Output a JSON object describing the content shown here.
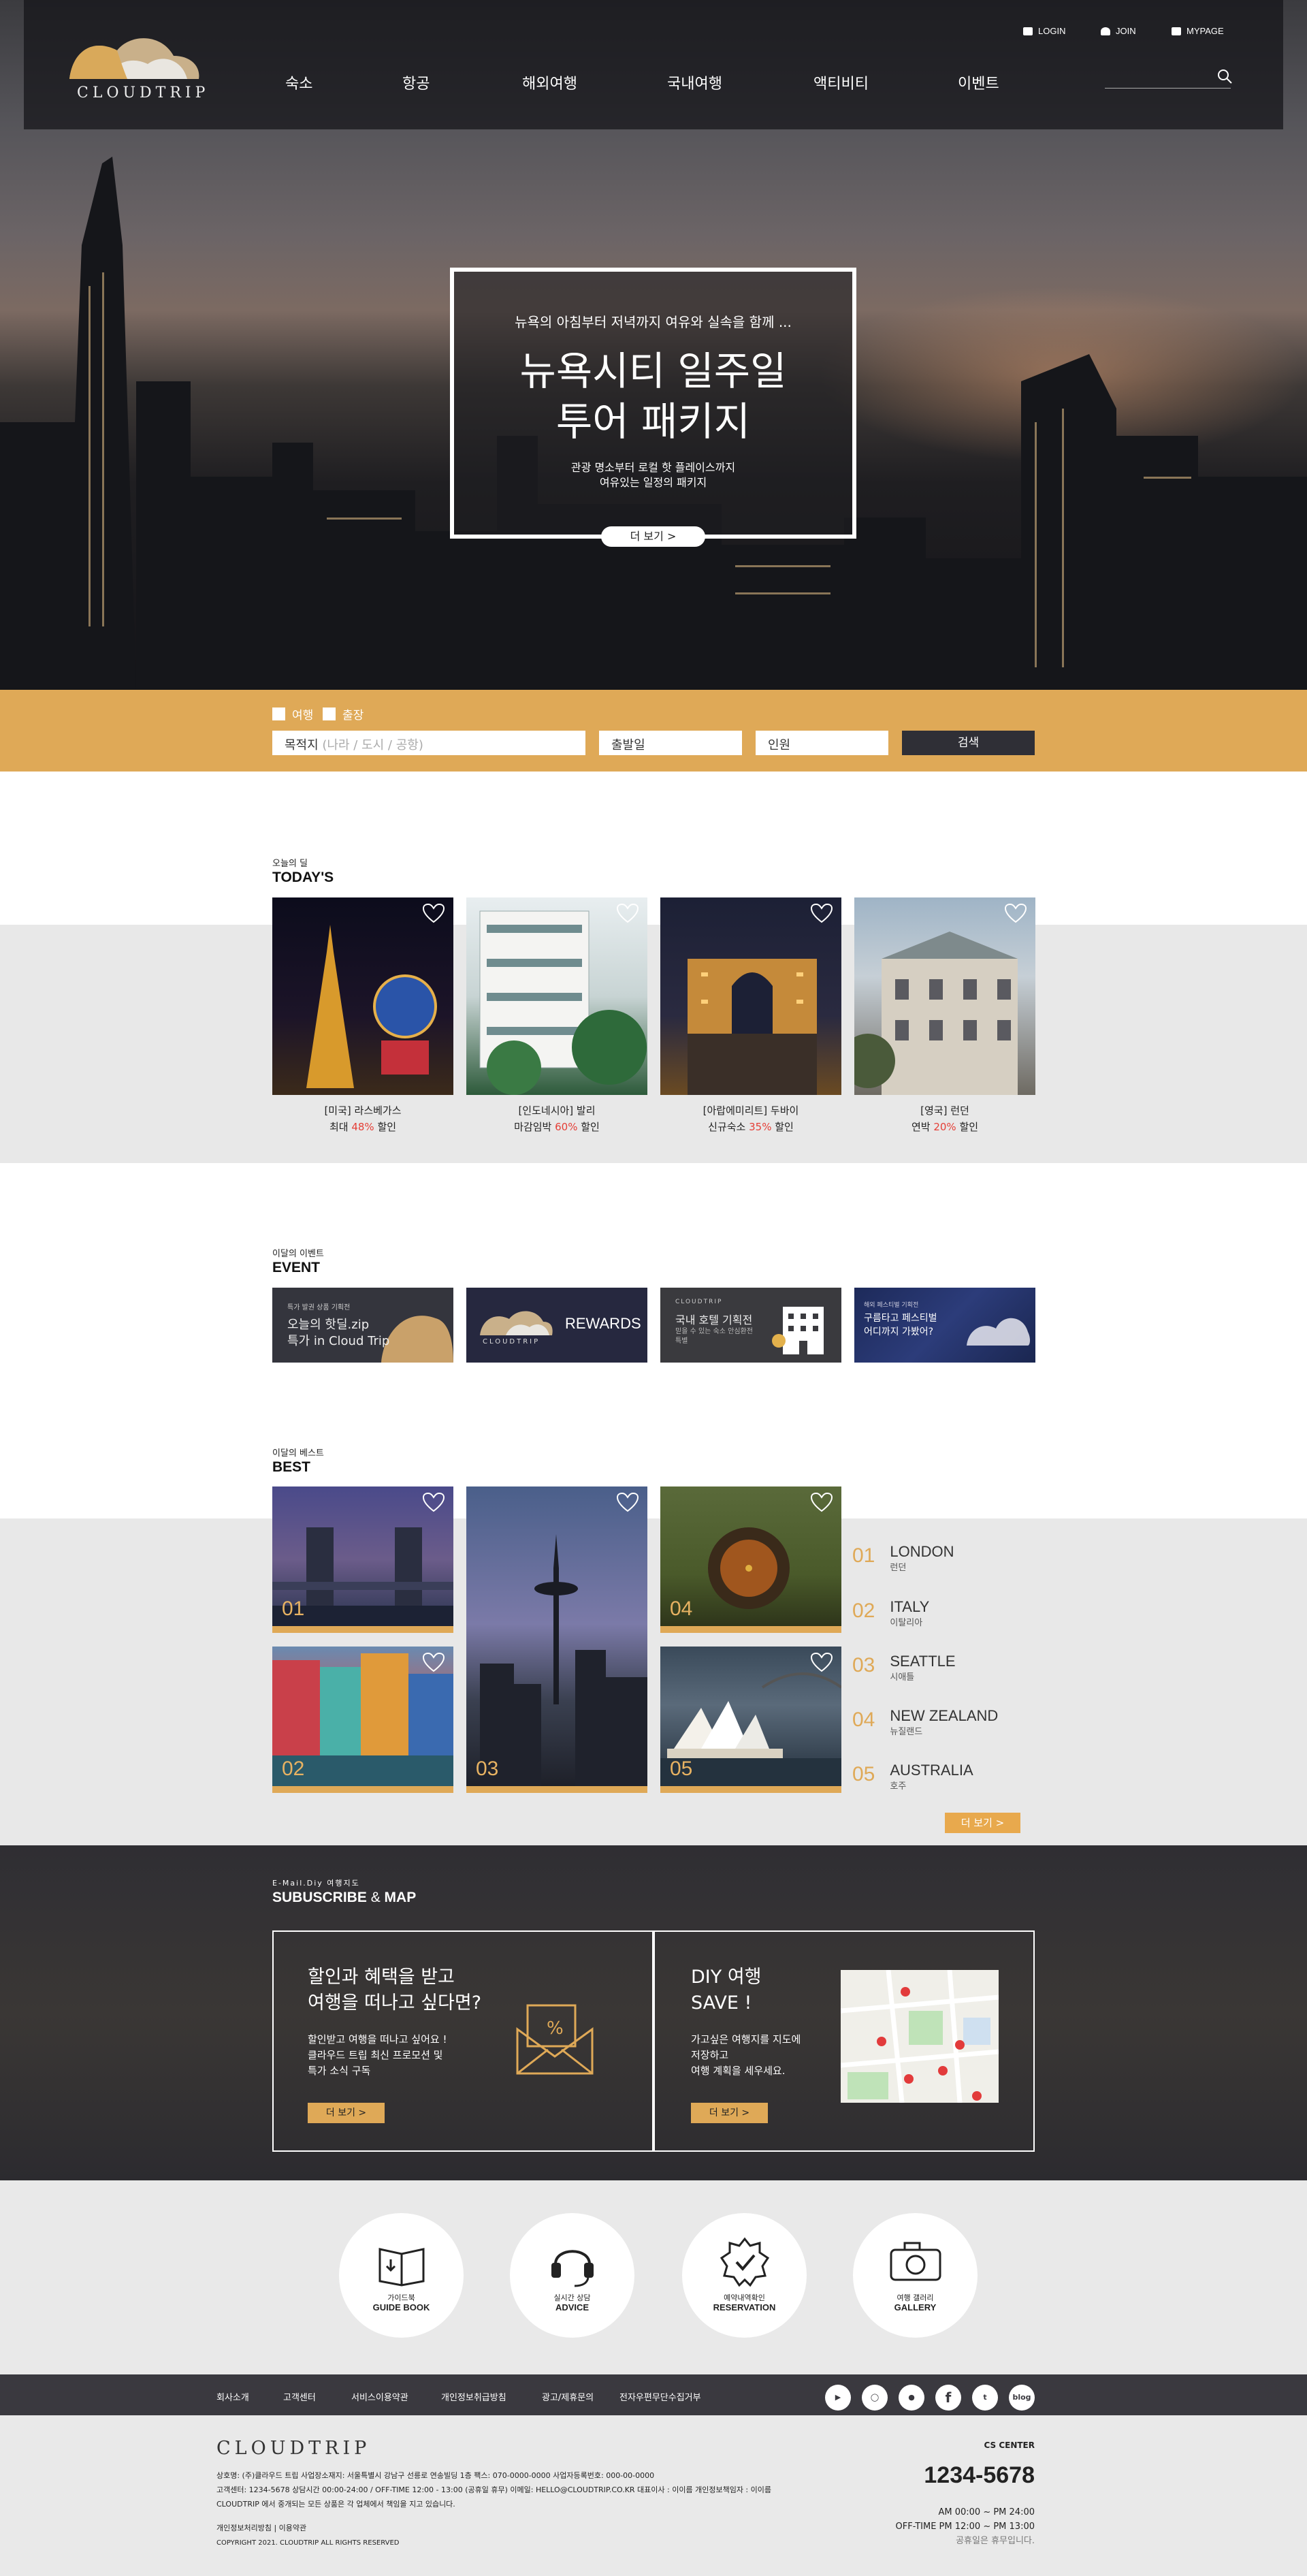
{
  "header": {
    "logo": "CLOUDTRIP",
    "util": {
      "login": "LOGIN",
      "join": "JOIN",
      "mypage": "MYPAGE"
    },
    "nav": [
      "숙소",
      "항공",
      "해외여행",
      "국내여행",
      "액티비티",
      "이벤트"
    ]
  },
  "hero": {
    "subtitle": "뉴욕의 아침부터 저녁까지 여유와 실속을 함께 ...",
    "title_line1": "뉴욕시티 일주일",
    "title_line2": "투어 패키지",
    "desc_line1": "관광 명소부터 로컬 핫 플레이스까지",
    "desc_line2": "여유있는 일정의 패키지",
    "more": "더 보기  >"
  },
  "search": {
    "opt1": "여행",
    "opt2": "출장",
    "dest_label": "목적지",
    "dest_placeholder": "(나라 / 도시 / 공항)",
    "date": "출발일",
    "people": "인원",
    "button": "검색"
  },
  "today": {
    "small": "오늘의 딜",
    "title": "TODAY'S",
    "items": [
      {
        "name": "[미국] 라스베가스",
        "pre": "최대 ",
        "pct": "48%",
        "post": " 할인"
      },
      {
        "name": "[인도네시아] 발리",
        "pre": "마감임박 ",
        "pct": "60%",
        "post": " 할인"
      },
      {
        "name": "[아랍에미리트] 두바이",
        "pre": "신규숙소 ",
        "pct": "35%",
        "post": " 할인"
      },
      {
        "name": "[영국] 런던",
        "pre": "연박 ",
        "pct": "20%",
        "post": " 할인"
      }
    ]
  },
  "event": {
    "small": "이달의 이벤트",
    "title": "EVENT",
    "items": [
      {
        "tag": "특가 발권 상품 기획전",
        "l1": "오늘의 핫딜.zip",
        "l2": "특가 in Cloud Trip"
      },
      {
        "tag": "CLOUDTRIP",
        "l1": "REWARDS",
        "l2": ""
      },
      {
        "tag": "CLOUDTRIP",
        "l1": "국내 호텔 기획전",
        "l2": "믿을 수 있는 숙소 안심환전특별"
      },
      {
        "tag": "해외 페스티벌 기획전",
        "l1": "구름타고 페스티벌",
        "l2": "어디까지 가봤어?"
      }
    ]
  },
  "best": {
    "small": "이달의 베스트",
    "title": "BEST",
    "tiles": [
      "01",
      "02",
      "03",
      "04",
      "05"
    ],
    "ranking": [
      {
        "n": "01",
        "en": "LONDON",
        "ko": "런던"
      },
      {
        "n": "02",
        "en": "ITALY",
        "ko": "이탈리아"
      },
      {
        "n": "03",
        "en": "SEATTLE",
        "ko": "시애틀"
      },
      {
        "n": "04",
        "en": "NEW ZEALAND",
        "ko": "뉴질랜드"
      },
      {
        "n": "05",
        "en": "AUSTRALIA",
        "ko": "호주"
      }
    ],
    "more": "더 보기  >"
  },
  "subscribe": {
    "small": "E-Mail.Diy 여행지도",
    "title_a": "SUBUSCRIBE",
    "title_amp": " & ",
    "title_b": "MAP",
    "left": {
      "t1": "할인과 혜택을 받고",
      "t2": "여행을 떠나고 싶다면?",
      "d1": "할인받고 여행을 떠나고 싶어요 !",
      "d2": "클라우드 트립 최신 프로모션 및",
      "d3": "특가 소식 구독",
      "btn": "더 보기  >"
    },
    "right": {
      "t1": "DIY 여행",
      "t2": "SAVE !",
      "d1": "가고싶은 여행지를 지도에",
      "d2": "저장하고",
      "d3": "여행 계획을 세우세요.",
      "btn": "더 보기  >"
    }
  },
  "services": [
    {
      "ko": "가이드북",
      "en": "GUIDE BOOK"
    },
    {
      "ko": "실시간 상담",
      "en": "ADVICE"
    },
    {
      "ko": "예약내역확인",
      "en": "RESERVATION"
    },
    {
      "ko": "여행 갤러리",
      "en": "GALLERY"
    }
  ],
  "footnav": [
    "회사소개",
    "고객센터",
    "서비스이용약관",
    "개인정보취급방침",
    "광고/제휴문의",
    "전자우편무단수집거부"
  ],
  "social": [
    "youtube-icon",
    "instagram-icon",
    "talk-icon",
    "facebook-icon",
    "twitter-icon",
    "blog"
  ],
  "footer": {
    "logo": "CLOUDTRIP",
    "line1": "상호명: (주)클라우드 트립     사업장소재지: 서울특별시 강남구 선릉로 연송빌딩 1층     팩스: 070-0000-0000     사업자등록번호: 000-00-0000",
    "line2": "고객센터: 1234-5678     상담시간 00:00-24:00  /  OFF-TIME 12:00 - 13:00 (공휴일 휴무)   이메일: HELLO@CLOUDTRIP.CO.KR     대표이사 : 이이름     개인정보책임자 : 이이름",
    "line3": "CLOUDTRIP 에서 중개되는 모든 상품은 각 업체에서 책임을 지고 있습니다.",
    "line4": "개인정보처리방침   |   이용약관",
    "copyright": "COPYRIGHT 2021. CLOUDTRIP ALL RIGHTS RESERVED",
    "cs_label": "CS CENTER",
    "cs_phone": "1234-5678",
    "cs_h1": "AM 00:00 ~ PM 24:00",
    "cs_h2": "OFF-TIME PM 12:00 ~ PM 13:00",
    "cs_h3": "공휴일은 휴무입니다."
  }
}
